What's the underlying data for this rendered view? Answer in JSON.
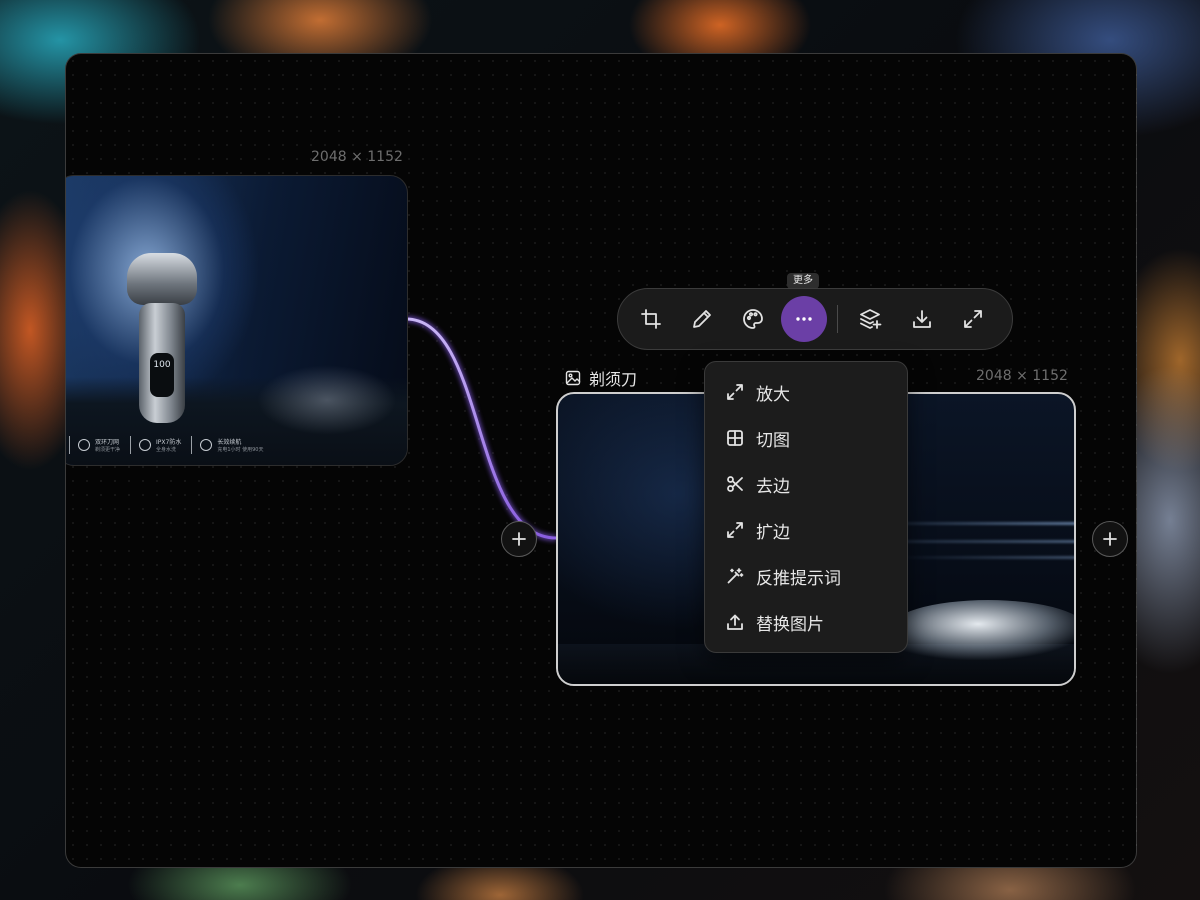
{
  "canvas": {
    "nodes": [
      {
        "dimensions": "2048 × 1152"
      },
      {
        "title": "剃须刀",
        "dimensions": "2048 × 1152"
      }
    ]
  },
  "image1": {
    "display": "100",
    "features": [
      {
        "label": "双环刀网",
        "sub": "剃须更干净"
      },
      {
        "label": "IPX7防水",
        "sub": "全身水洗"
      },
      {
        "label": "长效续航",
        "sub": "充电1小时 使用90天"
      }
    ]
  },
  "toolbar": {
    "tooltip": "更多",
    "buttons": [
      {
        "icon": "crop-icon"
      },
      {
        "icon": "pencil-icon"
      },
      {
        "icon": "palette-icon"
      },
      {
        "icon": "more-icon",
        "active": true
      },
      {
        "icon": "layers-add-icon"
      },
      {
        "icon": "download-icon"
      },
      {
        "icon": "fullscreen-icon"
      }
    ]
  },
  "menu": {
    "items": [
      {
        "label": "放大",
        "icon": "upscale-icon"
      },
      {
        "label": "切图",
        "icon": "grid-slice-icon"
      },
      {
        "label": "去边",
        "icon": "scissors-icon"
      },
      {
        "label": "扩边",
        "icon": "expand-icon"
      },
      {
        "label": "反推提示词",
        "icon": "magic-wand-icon"
      },
      {
        "label": "替换图片",
        "icon": "upload-icon"
      }
    ]
  },
  "colors": {
    "accent": "#6b3fa6",
    "connector": "#a88de8"
  }
}
